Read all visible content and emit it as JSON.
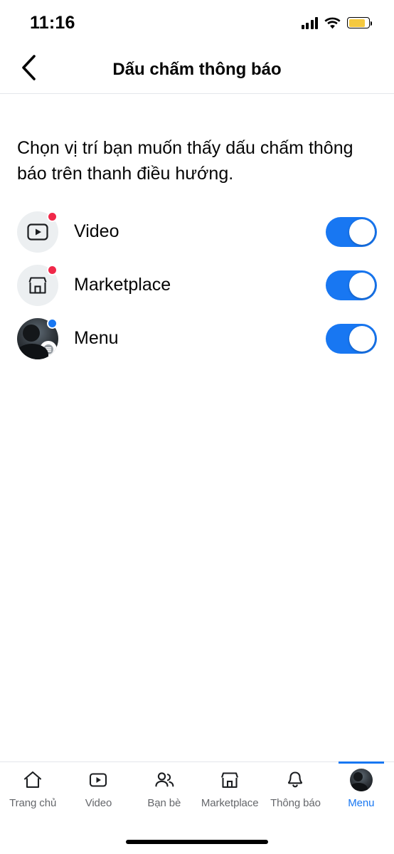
{
  "status_bar": {
    "time": "11:16",
    "signal_icon": "cellular-bars-icon",
    "wifi_icon": "wifi-icon",
    "battery_icon": "battery-icon",
    "battery_color": "#f5c93f",
    "battery_level_percent": 85
  },
  "header": {
    "back_icon": "chevron-left-icon",
    "title": "Dấu chấm thông báo"
  },
  "main": {
    "description": "Chọn vị trí bạn muốn thấy dấu chấm thông báo trên thanh điều hướng.",
    "accent_color": "#1877f2",
    "badge_red": "#f02849",
    "badge_blue": "#1877f2",
    "rows": [
      {
        "id": "video",
        "label": "Video",
        "icon": "video-play-icon",
        "badge_color": "#f02849",
        "toggle_state": "on",
        "toggle_label": "on"
      },
      {
        "id": "marketplace",
        "label": "Marketplace",
        "icon": "storefront-icon",
        "badge_color": "#f02849",
        "toggle_state": "on",
        "toggle_label": "on"
      },
      {
        "id": "menu",
        "label": "Menu",
        "icon": "profile-avatar-menu-icon",
        "badge_color": "#1877f2",
        "toggle_state": "on",
        "toggle_label": "on"
      }
    ]
  },
  "tabbar": {
    "tabs": [
      {
        "id": "home",
        "label": "Trang chủ",
        "icon": "home-icon",
        "active": false
      },
      {
        "id": "video",
        "label": "Video",
        "icon": "video-play-icon",
        "active": false
      },
      {
        "id": "friends",
        "label": "Bạn bè",
        "icon": "friends-icon",
        "active": false
      },
      {
        "id": "marketplace",
        "label": "Marketplace",
        "icon": "storefront-icon",
        "active": false
      },
      {
        "id": "notifications",
        "label": "Thông báo",
        "icon": "bell-icon",
        "active": false
      },
      {
        "id": "menu",
        "label": "Menu",
        "icon": "avatar-icon",
        "active": true
      }
    ]
  },
  "home_indicator": {
    "name": "home-indicator"
  }
}
